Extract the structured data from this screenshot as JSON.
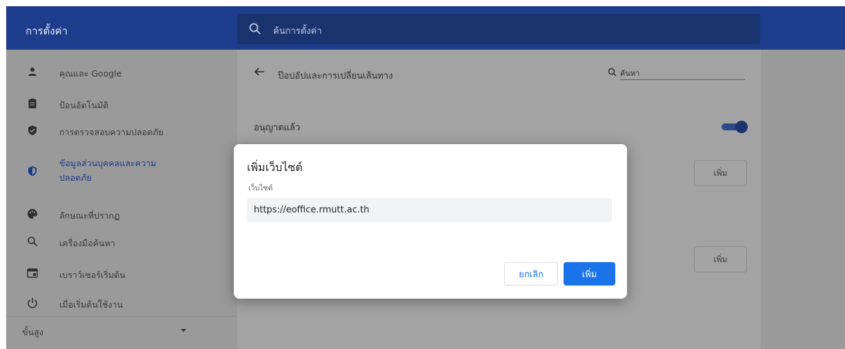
{
  "header": {
    "title": "การตั้งค่า",
    "search_placeholder": "ค้นการตั้งค่า"
  },
  "sidebar": {
    "items": [
      {
        "label": "คุณและ Google",
        "icon": "person-icon"
      },
      {
        "label": "ป้อนอัตโนมัติ",
        "icon": "clipboard-icon"
      },
      {
        "label": "การตรวจสอบความปลอดภัย",
        "icon": "shield-check-icon"
      },
      {
        "label": "ข้อมูลส่วนบุคคลและความ ปลอดภัย",
        "icon": "privacy-shield-icon",
        "active": true
      },
      {
        "label": "ลักษณะที่ปรากฏ",
        "icon": "palette-icon"
      },
      {
        "label": "เครื่องมือค้นหา",
        "icon": "search-icon"
      },
      {
        "label": "เบราว์เซอร์เริ่มต้น",
        "icon": "browser-icon"
      },
      {
        "label": "เมื่อเริ่มต้นใช้งาน",
        "icon": "power-icon"
      }
    ],
    "advanced_label": "ขั้นสูง"
  },
  "main": {
    "title": "ป๊อปอัปและการเปลี่ยนเส้นทาง",
    "search_label": "ค้นหา",
    "allowed_label": "อนุญาตแล้ว",
    "add_button_1": "เพิ่ม",
    "add_button_2": "เพิ่ม"
  },
  "dialog": {
    "title": "เพิ่มเว็บไซต์",
    "field_label": "เว็บไซต์",
    "input_value": "https://eoffice.rmutt.ac.th",
    "cancel_label": "ยกเลิก",
    "confirm_label": "เพิ่ม"
  },
  "colors": {
    "header_bg": "#1e3c8c",
    "accent": "#1a73e8"
  }
}
